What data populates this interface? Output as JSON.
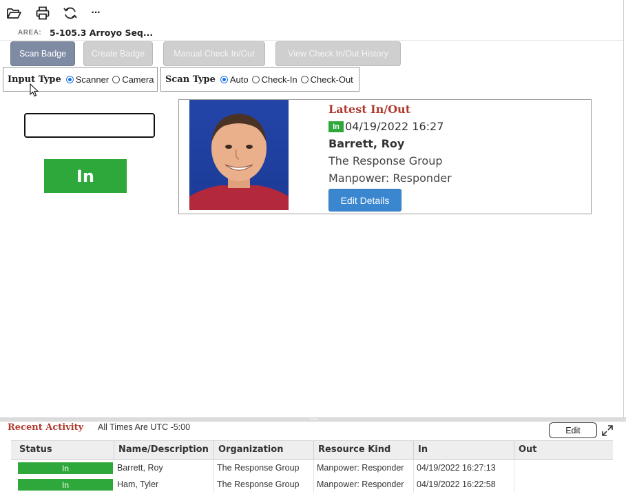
{
  "toolbar": {
    "icons": [
      "folder-open-icon",
      "print-icon",
      "refresh-icon",
      "more-icon"
    ],
    "more_label": "···"
  },
  "area": {
    "label": "AREA:",
    "value": "5-105.3 Arroyo Seq..."
  },
  "actions": {
    "scan_badge": "Scan Badge",
    "create_badge": "Create Badge",
    "manual_check": "Manual Check In/Out",
    "view_history": "View Check In/Out History"
  },
  "input_type": {
    "label": "Input Type",
    "options": [
      "Scanner",
      "Camera"
    ],
    "selected": "Scanner"
  },
  "scan_type": {
    "label": "Scan Type",
    "options": [
      "Auto",
      "Check-In",
      "Check-Out"
    ],
    "selected": "Auto"
  },
  "scan": {
    "input_value": "",
    "status": "In"
  },
  "latest": {
    "title": "Latest In/Out",
    "badge": "In",
    "datetime": "04/19/2022 16:27",
    "name": "Barrett, Roy",
    "organization": "The Response Group",
    "resource": "Manpower: Responder",
    "edit_label": "Edit Details"
  },
  "recent": {
    "title": "Recent Activity",
    "timezone_note": "All Times Are UTC -5:00",
    "edit_label": "Edit",
    "columns": [
      "Status",
      "Name/Description",
      "Organization",
      "Resource Kind",
      "In",
      "Out"
    ],
    "rows": [
      {
        "status": "In",
        "name": "Barrett, Roy",
        "organization": "The Response Group",
        "resource": "Manpower: Responder",
        "in": "04/19/2022 16:27:13",
        "out": ""
      },
      {
        "status": "In",
        "name": "Ham, Tyler",
        "organization": "The Response Group",
        "resource": "Manpower: Responder",
        "in": "04/19/2022 16:22:58",
        "out": ""
      }
    ]
  },
  "colors": {
    "accent_red": "#b03a2e",
    "status_green": "#2ea83a",
    "primary_blue": "#3a87d0",
    "button_gray": "#7f8ba3"
  }
}
